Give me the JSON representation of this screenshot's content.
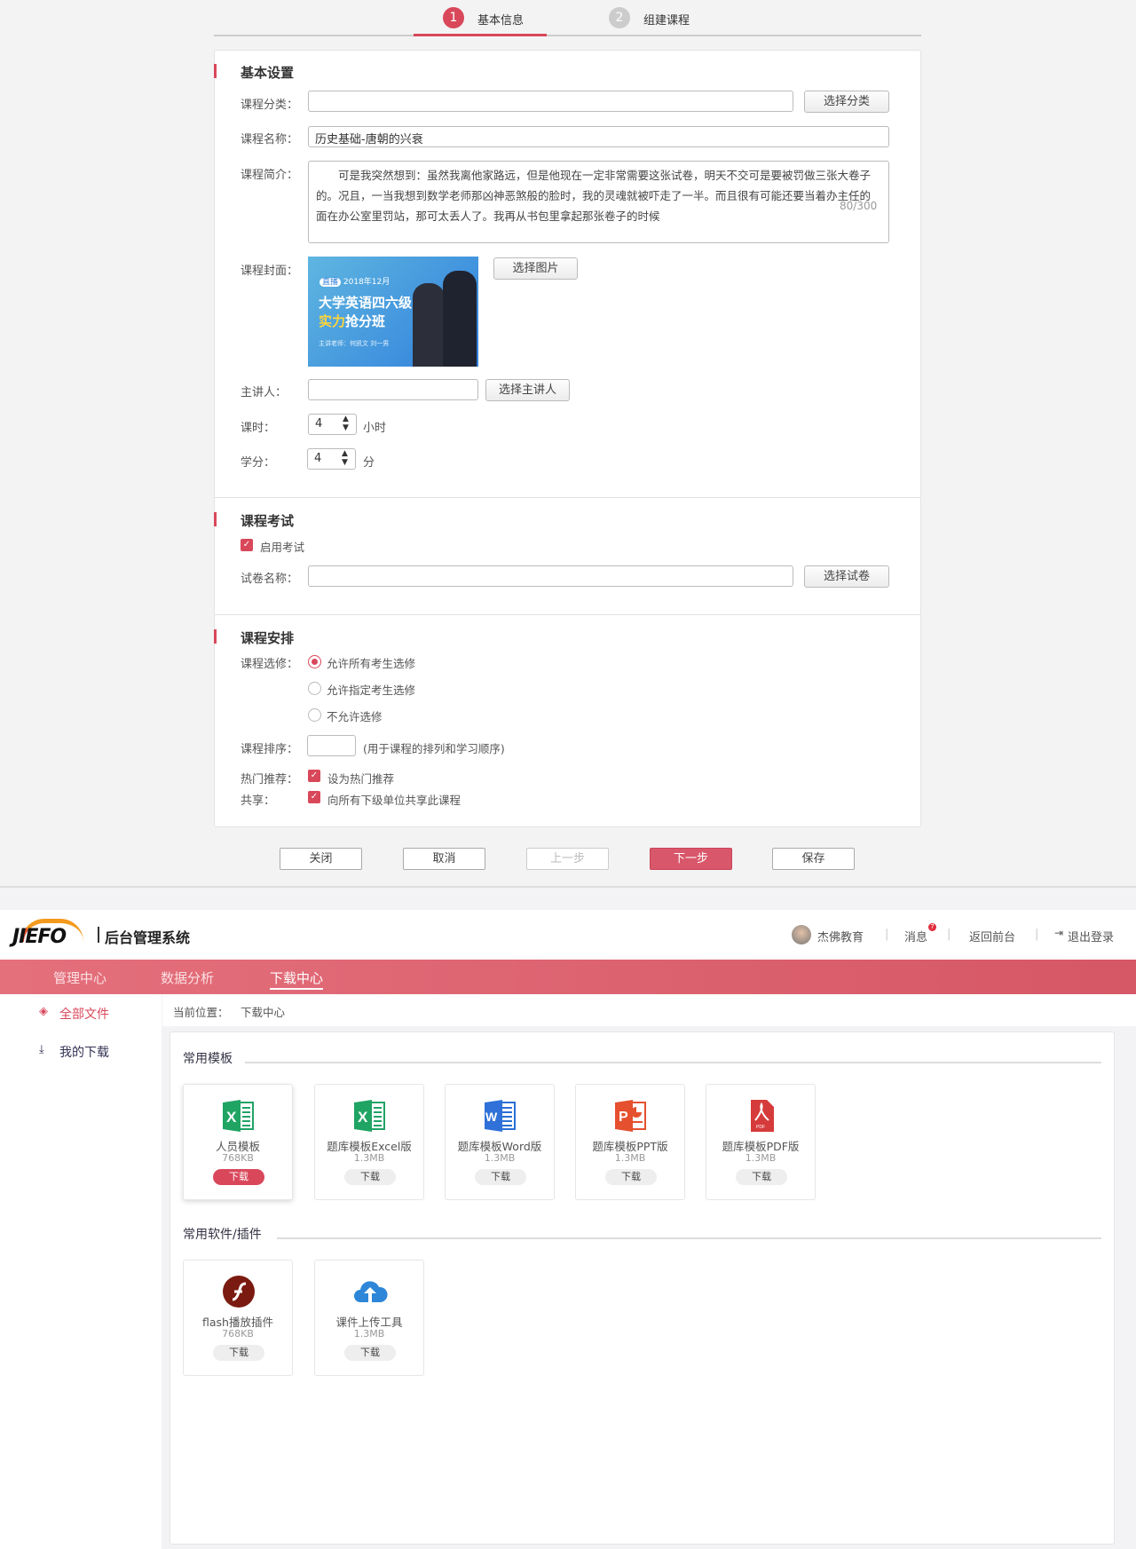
{
  "steps": [
    {
      "num": "1",
      "label": "基本信息"
    },
    {
      "num": "2",
      "label": "组建课程"
    }
  ],
  "basic": {
    "title": "基本设置",
    "category_label": "课程分类：",
    "category_value": "",
    "category_btn": "选择分类",
    "name_label": "课程名称：",
    "name_value": "历史基础-唐朝的兴衰",
    "intro_label": "课程简介：",
    "intro_value": "　　可是我突然想到：虽然我离他家路远，但是他现在一定非常需要这张试卷，明天不交可是要被罚做三张大卷子的。况且，一当我想到数学老师那凶神恶煞般的脸时，我的灵魂就被吓走了一半。而且很有可能还要当着办主任的面在办公室里罚站，那可太丢人了。我再从书包里拿起那张卷子的时候",
    "intro_count": "80/300",
    "cover_label": "课程封面：",
    "cover_btn": "选择图片",
    "cover_image": {
      "badge": "直播",
      "date": "2018年12月",
      "title1": "大学英语四六级",
      "title2a": "实力",
      "title2b": "抢分班",
      "teachers": "主讲老师：何凯文 刘一男"
    },
    "lecturer_label": "主讲人：",
    "lecturer_value": "",
    "lecturer_btn": "选择主讲人",
    "hours_label": "课时：",
    "hours_value": "4",
    "hours_unit": "小时",
    "credit_label": "学分：",
    "credit_value": "4",
    "credit_unit": "分"
  },
  "exam": {
    "title": "课程考试",
    "enable_label": "启用考试",
    "paper_label": "试卷名称：",
    "paper_value": "",
    "paper_btn": "选择试卷"
  },
  "schedule": {
    "title": "课程安排",
    "elective_label": "课程选修：",
    "options": [
      "允许所有考生选修",
      "允许指定考生选修",
      "不允许选修"
    ],
    "order_label": "课程排序：",
    "order_value": "",
    "order_hint": "(用于课程的排列和学习顺序)",
    "hot_label": "热门推荐：",
    "hot_check": "设为热门推荐",
    "share_label": "共享：",
    "share_check": "向所有下级单位共享此课程"
  },
  "footer_buttons": {
    "close": "关闭",
    "cancel": "取消",
    "prev": "上一步",
    "next": "下一步",
    "save": "保存"
  },
  "header": {
    "logo": "JIEFO",
    "system": "后台管理系统",
    "user": "杰佛教育",
    "messages": "消息",
    "msg_badge": "7",
    "back": "返回前台",
    "logout": "退出登录"
  },
  "nav": [
    "管理中心",
    "数据分析",
    "下载中心"
  ],
  "side": [
    "全部文件",
    "我的下载"
  ],
  "breadcrumb": {
    "label": "当前位置：",
    "current": "下载中心"
  },
  "templates": {
    "title": "常用模板",
    "items": [
      {
        "name": "人员模板",
        "size": "768KB",
        "btn": "下载",
        "icon": "excel"
      },
      {
        "name": "题库模板Excel版",
        "size": "1.3MB",
        "btn": "下载",
        "icon": "excel"
      },
      {
        "name": "题库模板Word版",
        "size": "1.3MB",
        "btn": "下载",
        "icon": "word"
      },
      {
        "name": "题库模板PPT版",
        "size": "1.3MB",
        "btn": "下载",
        "icon": "ppt"
      },
      {
        "name": "题库模板PDF版",
        "size": "1.3MB",
        "btn": "下载",
        "icon": "pdf"
      }
    ]
  },
  "software": {
    "title": "常用软件/插件",
    "items": [
      {
        "name": "flash播放插件",
        "size": "768KB",
        "btn": "下载",
        "icon": "flash"
      },
      {
        "name": "课件上传工具",
        "size": "1.3MB",
        "btn": "下载",
        "icon": "cloud-upload"
      }
    ]
  },
  "colors": {
    "accent": "#d9475a",
    "nav": "#dd6170"
  }
}
